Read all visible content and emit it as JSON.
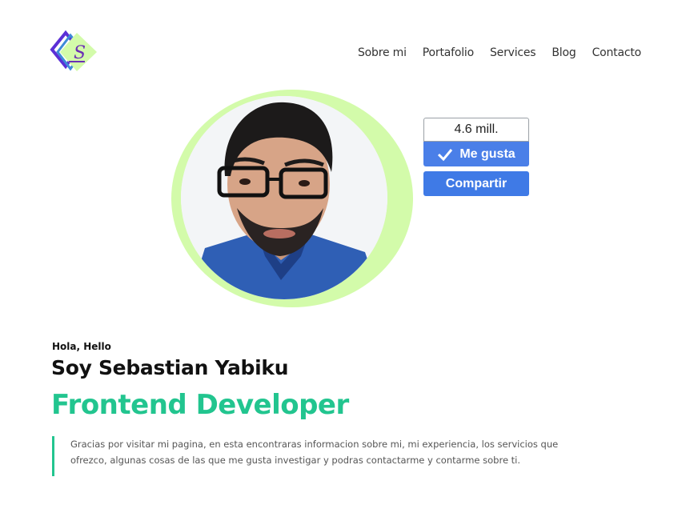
{
  "nav": {
    "items": [
      {
        "label": "Sobre mi"
      },
      {
        "label": "Portafolio"
      },
      {
        "label": "Services"
      },
      {
        "label": "Blog"
      },
      {
        "label": "Contacto"
      }
    ]
  },
  "widget": {
    "count": "4.6 mill.",
    "like_label": "Me gusta",
    "share_label": "Compartir",
    "check_icon": "checkmark-icon"
  },
  "hero": {
    "greeting": "Hola, Hello",
    "name": "Soy Sebastian Yabiku",
    "role": "Frontend Developer",
    "description": "Gracias por visitar mi pagina, en esta encontraras informacion sobre mi, mi experiencia, los servicios que ofrezco, algunas cosas de las que me gusta investigar y podras contactarme y contarme sobre ti."
  },
  "colors": {
    "accent_green": "#22c58f",
    "ring_green": "#d3fbaa",
    "button_blue": "#4a7fe8",
    "logo_purple": "#5b2fd6"
  }
}
